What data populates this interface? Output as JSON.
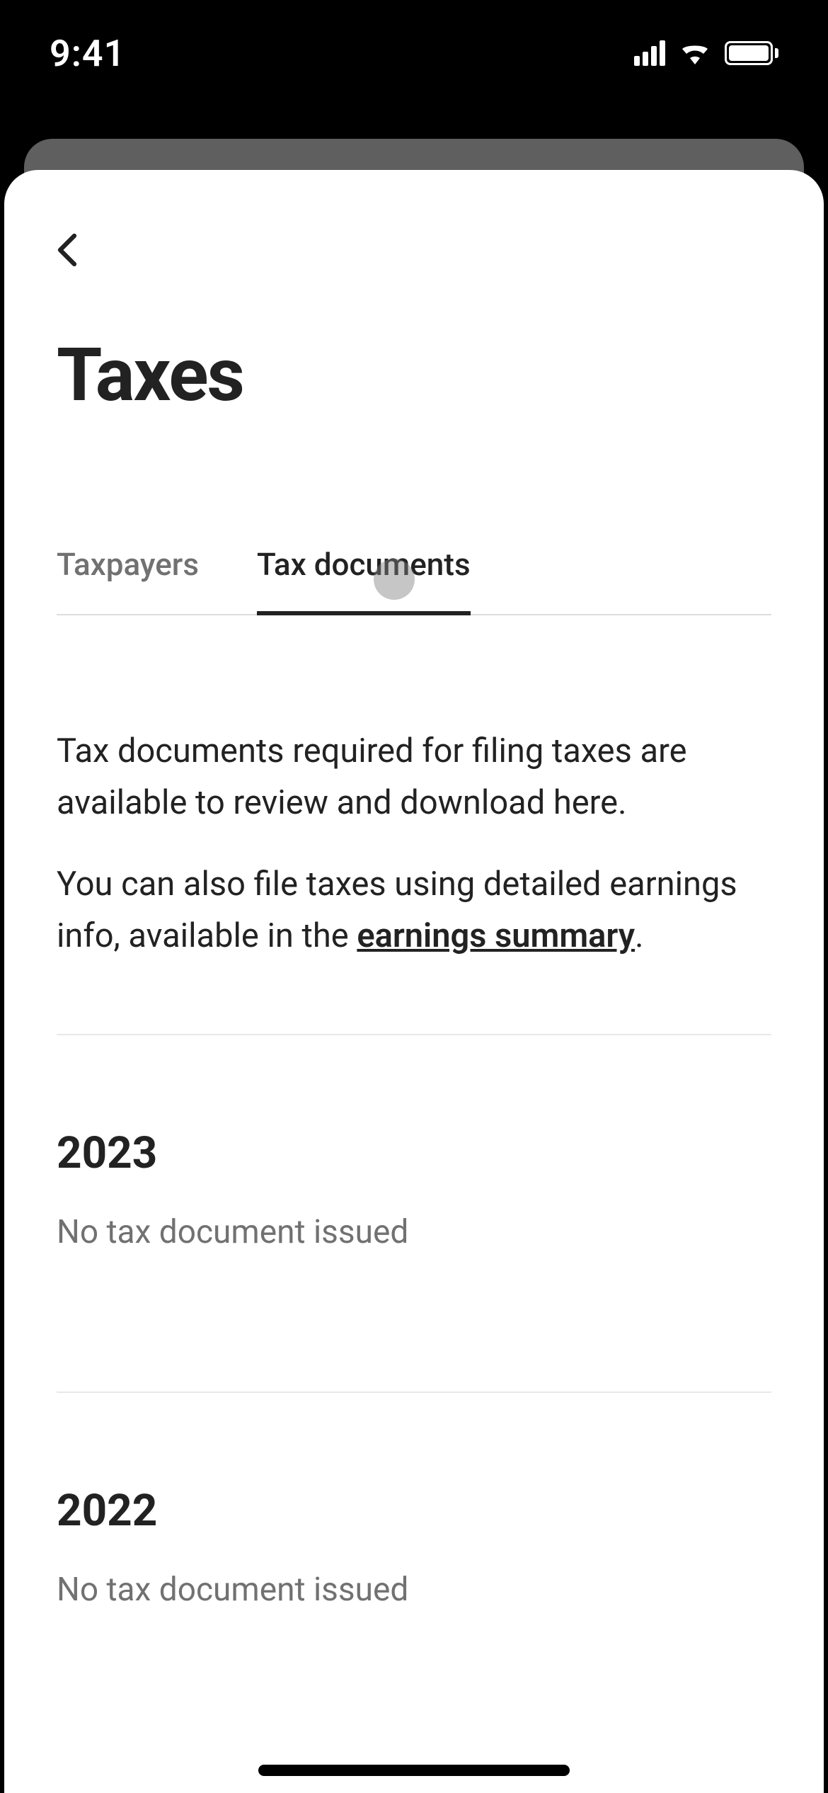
{
  "statusBar": {
    "time": "9:41"
  },
  "page": {
    "title": "Taxes"
  },
  "tabs": [
    {
      "label": "Taxpayers",
      "active": false
    },
    {
      "label": "Tax documents",
      "active": true
    }
  ],
  "description": {
    "para1": "Tax documents required for filing taxes are available to review and download here.",
    "para2_prefix": "You can also file taxes using detailed earnings info, available in the ",
    "para2_link": "earnings summary",
    "para2_suffix": "."
  },
  "years": [
    {
      "year": "2023",
      "status": "No tax document issued"
    },
    {
      "year": "2022",
      "status": "No tax document issued"
    }
  ]
}
